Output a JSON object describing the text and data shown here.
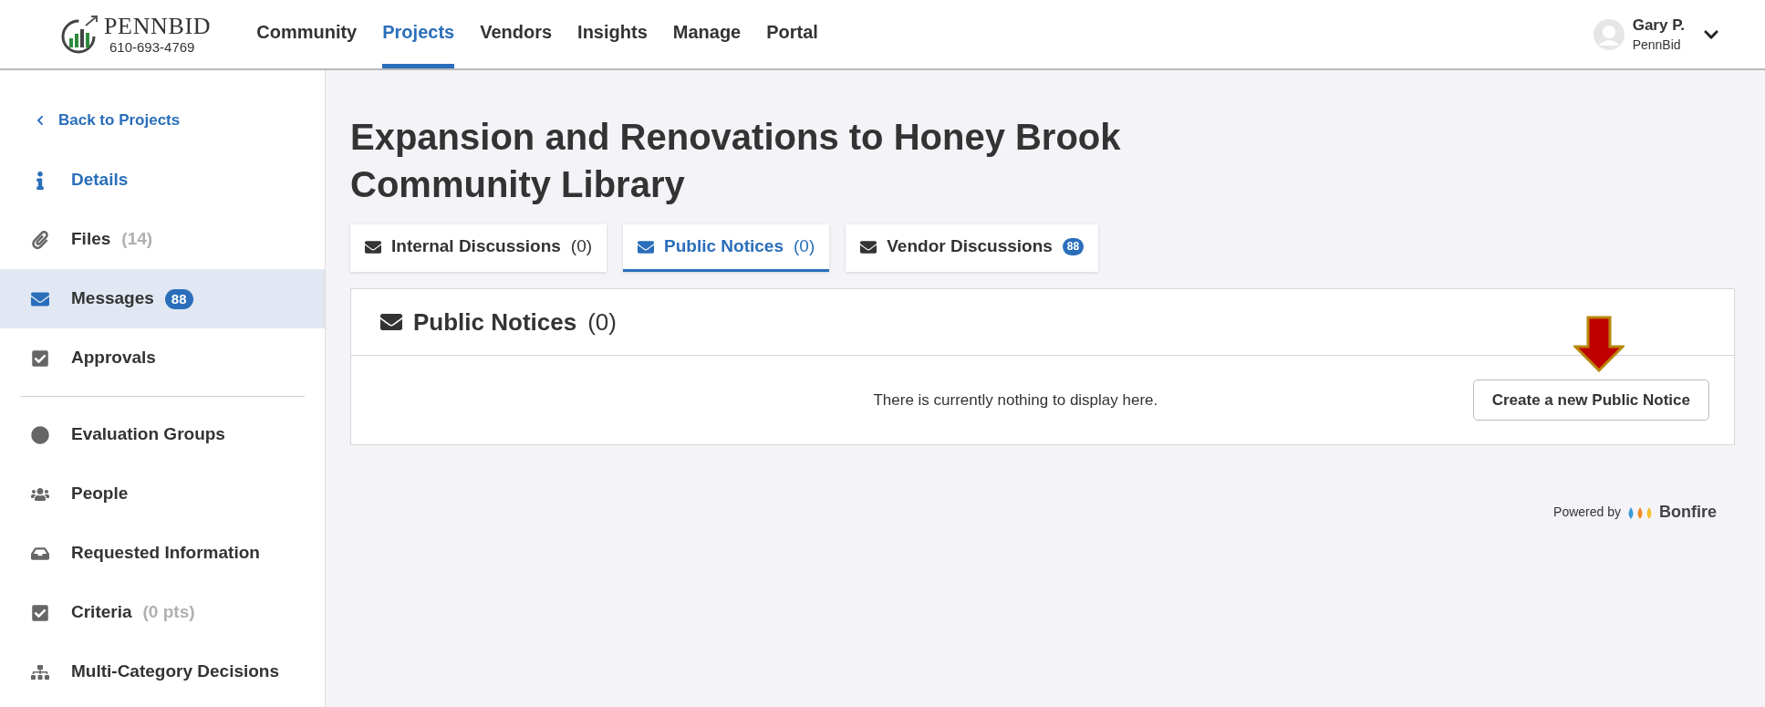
{
  "header": {
    "logo_text": "PENNBID",
    "phone": "610-693-4769",
    "nav": [
      {
        "label": "Community",
        "selected": false
      },
      {
        "label": "Projects",
        "selected": true
      },
      {
        "label": "Vendors",
        "selected": false
      },
      {
        "label": "Insights",
        "selected": false
      },
      {
        "label": "Manage",
        "selected": false
      },
      {
        "label": "Portal",
        "selected": false
      }
    ],
    "user": {
      "name": "Gary P.",
      "org": "PennBid"
    }
  },
  "sidebar": {
    "back_link": "Back to Projects",
    "groups": [
      [
        {
          "label": "Details",
          "kind": "accent",
          "selected": false
        },
        {
          "label": "Files",
          "count": "(14)",
          "kind": "plain",
          "selected": false
        },
        {
          "label": "Messages",
          "badge": "88",
          "kind": "plain",
          "selected": true
        },
        {
          "label": "Approvals",
          "kind": "plain",
          "selected": false
        }
      ],
      [
        {
          "label": "Evaluation Groups",
          "kind": "plain",
          "selected": false
        },
        {
          "label": "People",
          "kind": "plain",
          "selected": false
        },
        {
          "label": "Requested Information",
          "kind": "plain",
          "selected": false
        },
        {
          "label": "Criteria",
          "count": "(0 pts)",
          "kind": "plain",
          "selected": false
        },
        {
          "label": "Multi-Category Decisions",
          "kind": "plain",
          "selected": false
        }
      ]
    ]
  },
  "title": "Expansion and Renovations to Honey Brook Community Library",
  "tabs": [
    {
      "label": "Internal Discussions",
      "count": "(0)",
      "selected": false
    },
    {
      "label": "Public Notices",
      "count": "(0)",
      "selected": true
    },
    {
      "label": "Vendor Discussions",
      "badge": "88",
      "selected": false
    }
  ],
  "panel": {
    "title": "Public Notices",
    "count": "(0)",
    "empty_text": "There is currently nothing to display here.",
    "button": "Create a new Public Notice"
  },
  "footer": {
    "powered_by": "Powered by",
    "brand": "Bonfire"
  }
}
